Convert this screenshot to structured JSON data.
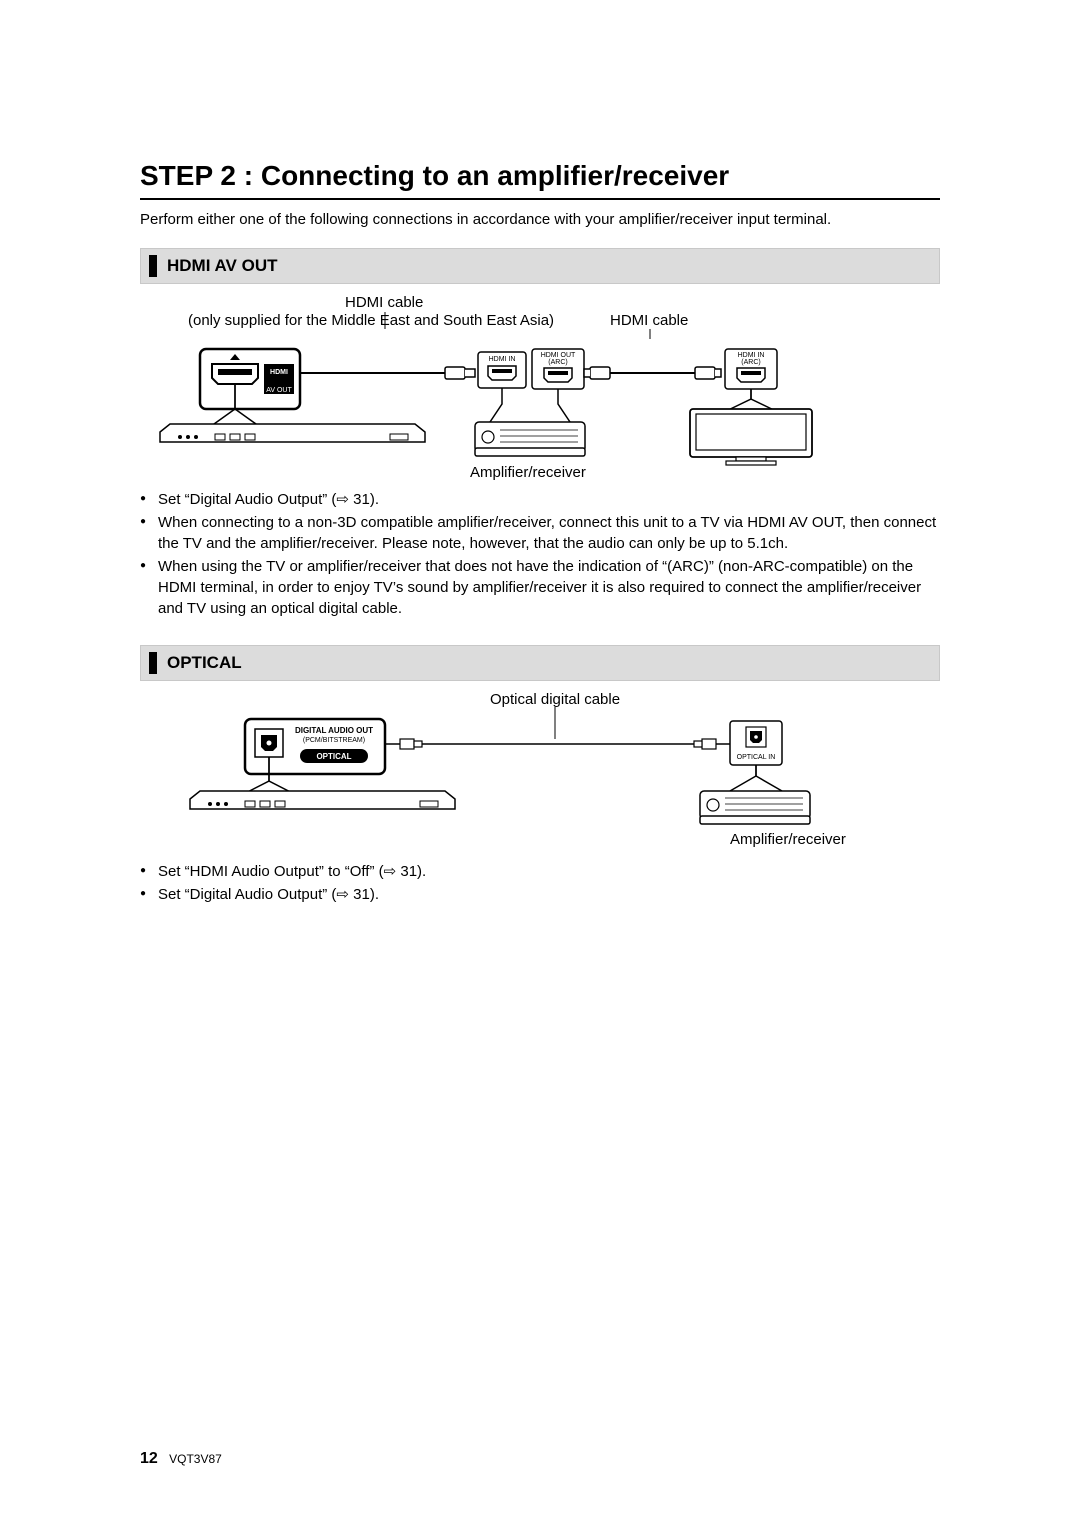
{
  "title": "STEP 2 :  Connecting to an amplifier/receiver",
  "intro": "Perform either one of the following connections in accordance with your amplifier/receiver input terminal.",
  "sections": {
    "hdmi": {
      "title": "HDMI AV OUT",
      "labels": {
        "hdmi_cable_top": "HDMI cable",
        "hdmi_cable_note": "(only supplied for the Middle East and South East Asia)",
        "hdmi_cable_right": "HDMI cable",
        "amp": "Amplifier/receiver",
        "hdmi_in": "HDMI IN",
        "hdmi_out_arc": "HDMI OUT (ARC)",
        "hdmi_in_arc": "HDMI IN (ARC)",
        "hdmi_logo": "HDMI",
        "av_out": "AV OUT"
      },
      "bullets": [
        "Set “Digital Audio Output” (⇨ 31).",
        "When connecting to a non-3D compatible amplifier/receiver, connect this unit to a TV via HDMI AV OUT, then connect the TV and the amplifier/receiver. Please note, however, that the audio can only be up to 5.1ch.",
        "When using the TV or amplifier/receiver that does not have the indication of “(ARC)” (non-ARC-compatible) on the HDMI terminal, in order to enjoy TV’s sound by amplifier/receiver it is also required to connect the amplifier/receiver and TV using an optical digital cable."
      ]
    },
    "optical": {
      "title": "OPTICAL",
      "labels": {
        "optical_cable": "Optical digital cable",
        "amp": "Amplifier/receiver",
        "digital_audio_out": "DIGITAL AUDIO OUT",
        "pcm": "(PCM/BITSTREAM)",
        "optical": "OPTICAL",
        "optical_in": "OPTICAL IN"
      },
      "bullets": [
        "Set “HDMI Audio Output” to “Off” (⇨ 31).",
        "Set “Digital Audio Output” (⇨ 31)."
      ]
    }
  },
  "footer": {
    "page_number": "12",
    "doc_id": "VQT3V87"
  }
}
